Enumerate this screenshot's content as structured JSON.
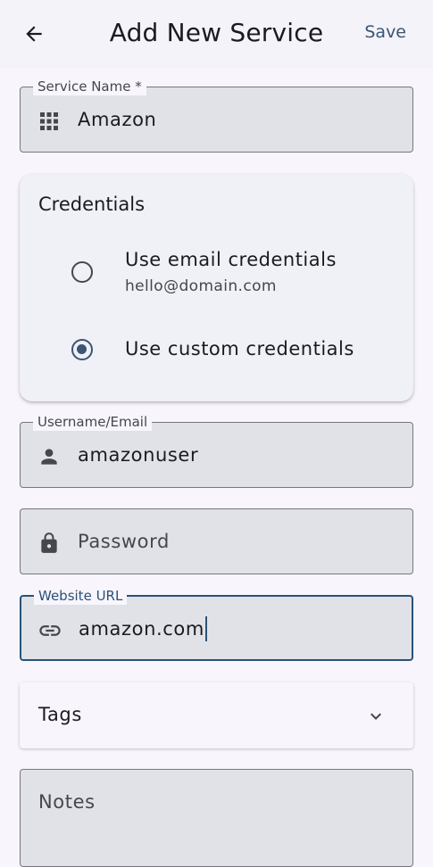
{
  "header": {
    "title": "Add New Service",
    "save_label": "Save",
    "back_icon": "arrow-left-icon"
  },
  "service_name": {
    "label": "Service Name *",
    "value": "Amazon",
    "icon": "apps-grid-icon"
  },
  "credentials": {
    "title": "Credentials",
    "options": [
      {
        "label": "Use email credentials",
        "sublabel": "hello@domain.com",
        "selected": false
      },
      {
        "label": "Use custom credentials",
        "selected": true
      }
    ]
  },
  "username": {
    "label": "Username/Email",
    "value": "amazonuser",
    "icon": "person-icon"
  },
  "password": {
    "placeholder": "Password",
    "icon": "lock-icon"
  },
  "website": {
    "label": "Website URL",
    "value": "amazon.com",
    "icon": "link-icon"
  },
  "tags": {
    "label": "Tags",
    "icon": "chevron-down-icon"
  },
  "notes": {
    "placeholder": "Notes"
  },
  "colors": {
    "accent": "#3b5573",
    "focus": "#29527a",
    "field_bg": "#e1e2e7",
    "page_bg": "#f8f6fc"
  }
}
